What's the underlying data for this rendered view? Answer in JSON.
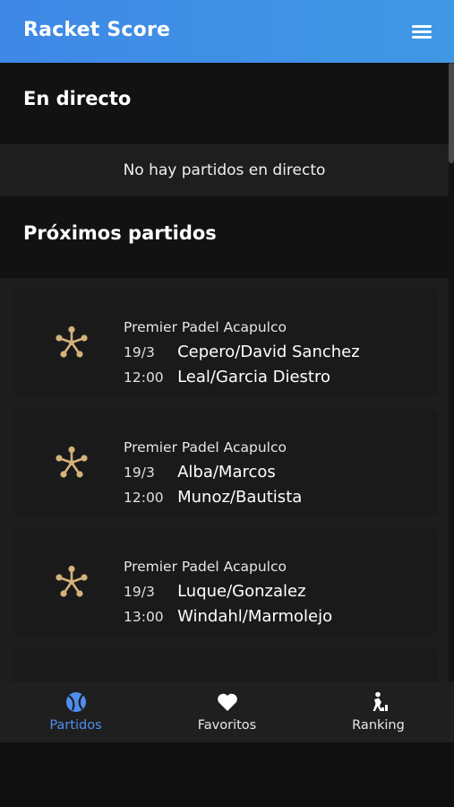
{
  "app": {
    "title": "Racket Score",
    "accent_color": "#3f90e5",
    "menu_icon": "hamburger-menu-icon"
  },
  "live": {
    "title": "En directo",
    "empty_message": "No hay partidos en directo"
  },
  "upcoming": {
    "title": "Próximos partidos",
    "matches": [
      {
        "tournament": "Premier Padel Acapulco",
        "date": "19/3",
        "time": "12:00",
        "team1": "Cepero/David Sanchez",
        "team2": "Leal/Garcia Diestro",
        "icon": "padel-tour-logo-icon"
      },
      {
        "tournament": "Premier Padel Acapulco",
        "date": "19/3",
        "time": "12:00",
        "team1": "Alba/Marcos",
        "team2": "Munoz/Bautista",
        "icon": "padel-tour-logo-icon"
      },
      {
        "tournament": "Premier Padel Acapulco",
        "date": "19/3",
        "time": "13:00",
        "team1": "Luque/Gonzalez",
        "team2": "Windahl/Marmolejo",
        "icon": "padel-tour-logo-icon"
      }
    ]
  },
  "nav": {
    "items": [
      {
        "label": "Partidos",
        "icon": "tennis-ball-icon",
        "active": true
      },
      {
        "label": "Favoritos",
        "icon": "heart-icon",
        "active": false
      },
      {
        "label": "Ranking",
        "icon": "ranking-icon",
        "active": false
      }
    ],
    "active_color": "#4f8ef0"
  },
  "colors": {
    "logo_gold": "#d4b27a"
  }
}
